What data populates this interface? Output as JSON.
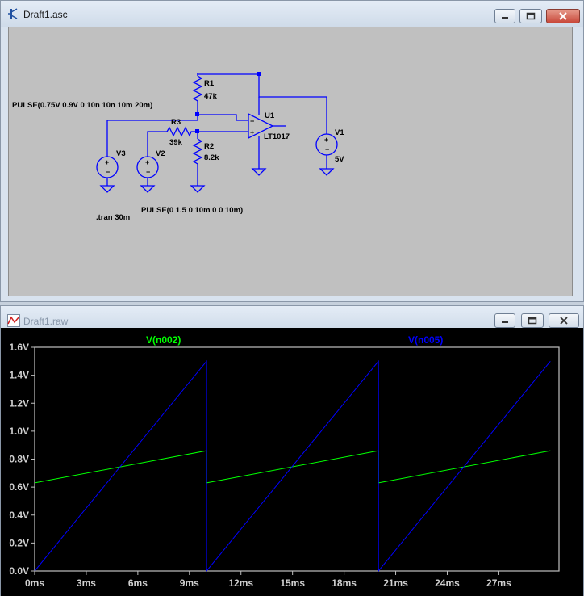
{
  "schematic_window": {
    "title": "Draft1.asc",
    "components": {
      "r1_name": "R1",
      "r1_value": "47k",
      "r2_name": "R2",
      "r2_value": "8.2k",
      "r3_name": "R3",
      "r3_value": "39k",
      "u1_name": "U1",
      "u1_value": "LT1017",
      "v1_name": "V1",
      "v1_value": "5V",
      "v2_name": "V2",
      "v3_name": "V3"
    },
    "directives": {
      "v3_source": "PULSE(0.75V 0.9V 0 10n 10n 10m 20m)",
      "v2_source": "PULSE(0 1.5 0 10m 0 0 10m)",
      "tran": ".tran 30m"
    },
    "colors": {
      "wire": "#0000ff",
      "background": "#c0c0c0",
      "ground": "#0000ff"
    }
  },
  "waveform_window": {
    "title": "Draft1.raw",
    "traces": [
      {
        "label": "V(n002)",
        "color": "#00ff00"
      },
      {
        "label": "V(n005)",
        "color": "#0000ff"
      }
    ],
    "background": "#000000"
  },
  "chart_data": {
    "type": "line",
    "xlabel": "",
    "ylabel": "",
    "xlim": [
      0,
      30.5
    ],
    "ylim": [
      0,
      1.6
    ],
    "xticks": [
      "0ms",
      "3ms",
      "6ms",
      "9ms",
      "12ms",
      "15ms",
      "18ms",
      "21ms",
      "24ms",
      "27ms"
    ],
    "xtick_values": [
      0,
      3,
      6,
      9,
      12,
      15,
      18,
      21,
      24,
      27
    ],
    "yticks": [
      "0.0V",
      "0.2V",
      "0.4V",
      "0.6V",
      "0.8V",
      "1.0V",
      "1.2V",
      "1.4V",
      "1.6V"
    ],
    "ytick_values": [
      0,
      0.2,
      0.4,
      0.6,
      0.8,
      1.0,
      1.2,
      1.4,
      1.6
    ],
    "grid": false,
    "legend": "top",
    "series": [
      {
        "name": "V(n002)",
        "color": "#00ff00",
        "points": [
          [
            0,
            0.63
          ],
          [
            10,
            0.86
          ],
          [
            10,
            0.63
          ],
          [
            20,
            0.86
          ],
          [
            20,
            0.63
          ],
          [
            30,
            0.86
          ]
        ]
      },
      {
        "name": "V(n005)",
        "color": "#0000ff",
        "points": [
          [
            0,
            0.0
          ],
          [
            10,
            1.5
          ],
          [
            10,
            0.0
          ],
          [
            20,
            1.5
          ],
          [
            20,
            0.0
          ],
          [
            30,
            1.5
          ]
        ]
      }
    ]
  }
}
